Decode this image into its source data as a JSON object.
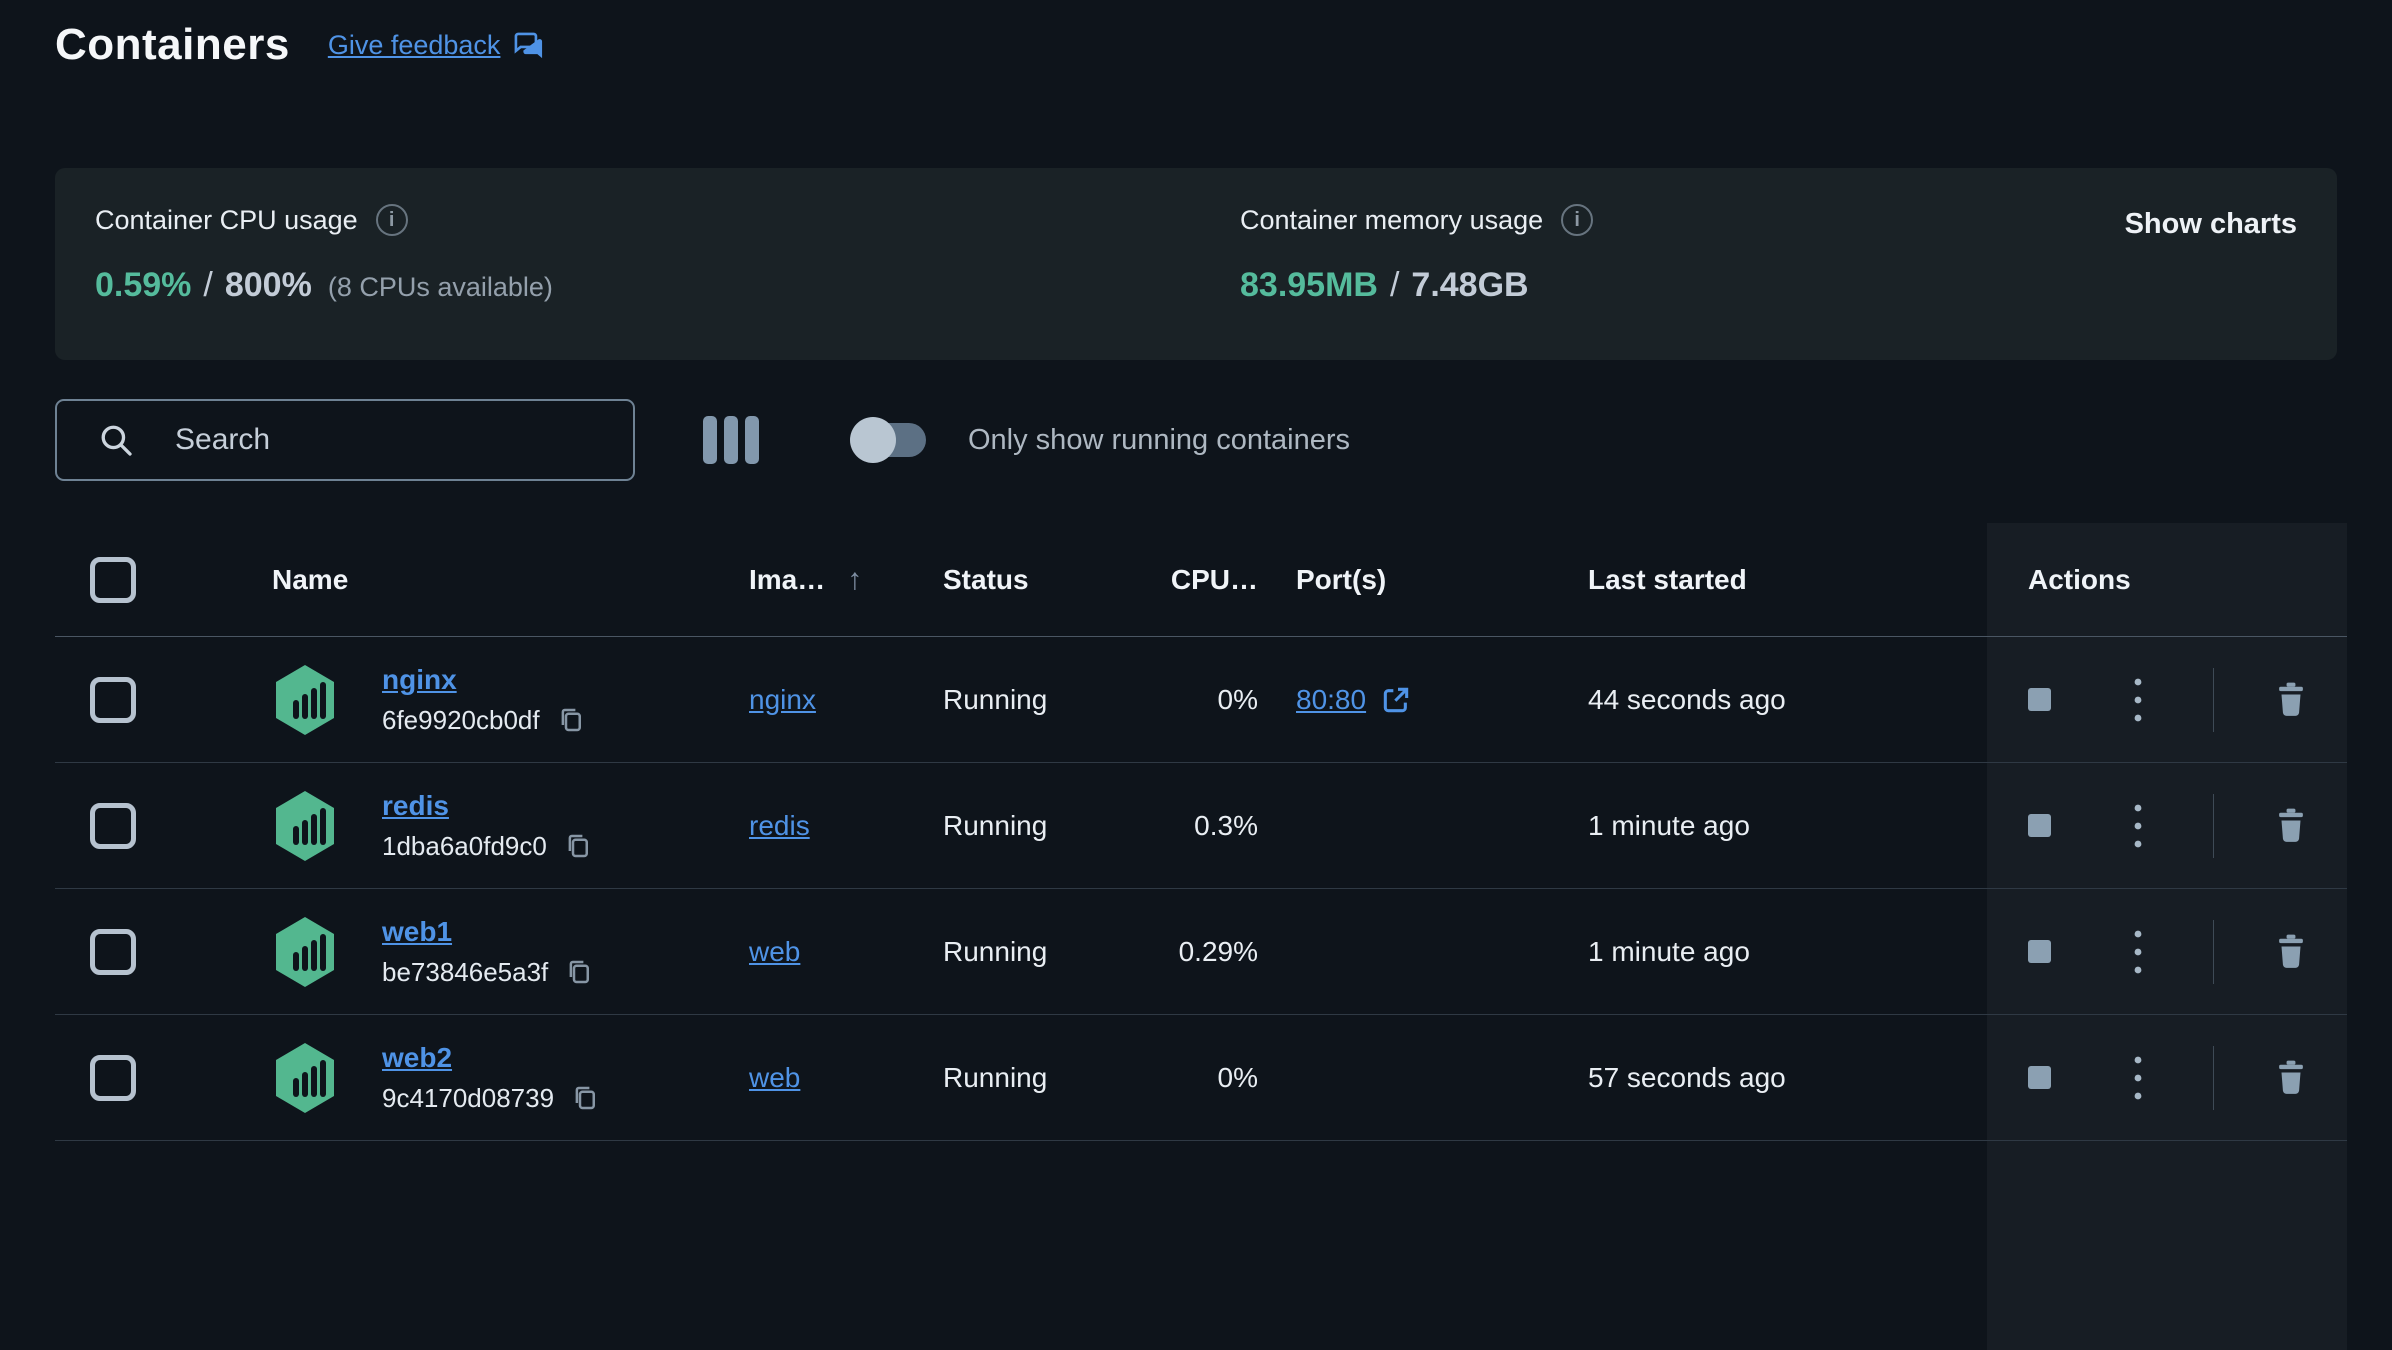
{
  "page": {
    "title": "Containers",
    "feedback_link": "Give feedback"
  },
  "stats": {
    "cpu": {
      "label": "Container CPU usage",
      "used": "0.59%",
      "separator": "/",
      "total": "800%",
      "note": "(8 CPUs available)"
    },
    "memory": {
      "label": "Container memory usage",
      "used": "83.95MB",
      "separator": "/",
      "total": "7.48GB"
    },
    "show_charts": "Show charts"
  },
  "toolbar": {
    "search_placeholder": "Search",
    "toggle_label": "Only show running containers",
    "toggle_state": "off"
  },
  "icons": {
    "info": "i",
    "sort_ascending": "↑"
  },
  "colors": {
    "accent_teal": "#55bb9c",
    "link_blue": "#4f93e6",
    "container_icon_green": "#53b78f",
    "page_background": "#0e141b",
    "card_background": "#1a2226",
    "actions_band_background": "#171d24"
  },
  "table": {
    "headers": {
      "name": "Name",
      "image": "Ima…",
      "status": "Status",
      "cpu": "CPU…",
      "ports": "Port(s)",
      "last_started": "Last started",
      "actions": "Actions"
    },
    "rows": [
      {
        "name": "nginx",
        "id": "6fe9920cb0df",
        "image": "nginx",
        "status": "Running",
        "cpu": "0%",
        "ports": "80:80",
        "last_started": "44 seconds ago"
      },
      {
        "name": "redis",
        "id": "1dba6a0fd9c0",
        "image": "redis",
        "status": "Running",
        "cpu": "0.3%",
        "ports": "",
        "last_started": "1 minute ago"
      },
      {
        "name": "web1",
        "id": "be73846e5a3f",
        "image": "web",
        "status": "Running",
        "cpu": "0.29%",
        "ports": "",
        "last_started": "1 minute ago"
      },
      {
        "name": "web2",
        "id": "9c4170d08739",
        "image": "web",
        "status": "Running",
        "cpu": "0%",
        "ports": "",
        "last_started": "57 seconds ago"
      }
    ]
  }
}
